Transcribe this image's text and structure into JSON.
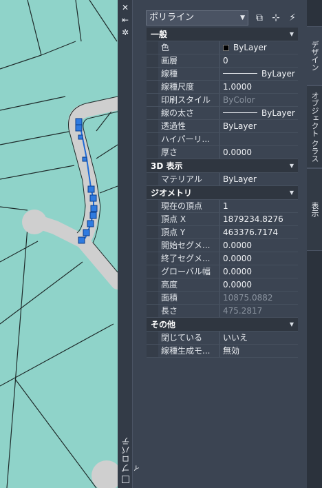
{
  "palette": {
    "title": "プロパティ",
    "object_type": "ポリライン",
    "tabs": [
      "デザイン",
      "オブジェクト クラス",
      "表示"
    ]
  },
  "sections": [
    {
      "title": "一般",
      "rows": [
        {
          "name": "色",
          "value": "ByLayer",
          "swatch": true
        },
        {
          "name": "画層",
          "value": "0"
        },
        {
          "name": "線種",
          "value": "ByLayer",
          "line": true
        },
        {
          "name": "線種尺度",
          "value": "1.0000"
        },
        {
          "name": "印刷スタイル",
          "value": "ByColor",
          "dim": true
        },
        {
          "name": "線の太さ",
          "value": "ByLayer",
          "line": true
        },
        {
          "name": "透過性",
          "value": "ByLayer"
        },
        {
          "name": "ハイパーリ...",
          "value": ""
        },
        {
          "name": "厚さ",
          "value": "0.0000"
        }
      ]
    },
    {
      "title": "3D 表示",
      "rows": [
        {
          "name": "マテリアル",
          "value": "ByLayer"
        }
      ]
    },
    {
      "title": "ジオメトリ",
      "rows": [
        {
          "name": "現在の頂点",
          "value": "1"
        },
        {
          "name": "頂点 X",
          "value": "1879234.8276"
        },
        {
          "name": "頂点 Y",
          "value": "463376.7174"
        },
        {
          "name": "開始セグメ...",
          "value": "0.0000"
        },
        {
          "name": "終了セグメ...",
          "value": "0.0000"
        },
        {
          "name": "グローバル幅",
          "value": "0.0000"
        },
        {
          "name": "高度",
          "value": "0.0000"
        },
        {
          "name": "面積",
          "value": "10875.0882",
          "dim": true
        },
        {
          "name": "長さ",
          "value": "475.2817",
          "dim": true
        }
      ]
    },
    {
      "title": "その他",
      "rows": [
        {
          "name": "閉じている",
          "value": "いいえ"
        },
        {
          "name": "線種生成モ...",
          "value": "無効"
        }
      ]
    }
  ],
  "colors": {
    "canvas": "#8fd3c9",
    "road": "#cfcfcf",
    "polyline": "#1f6bd6",
    "palette_bg": "#3b4452"
  }
}
